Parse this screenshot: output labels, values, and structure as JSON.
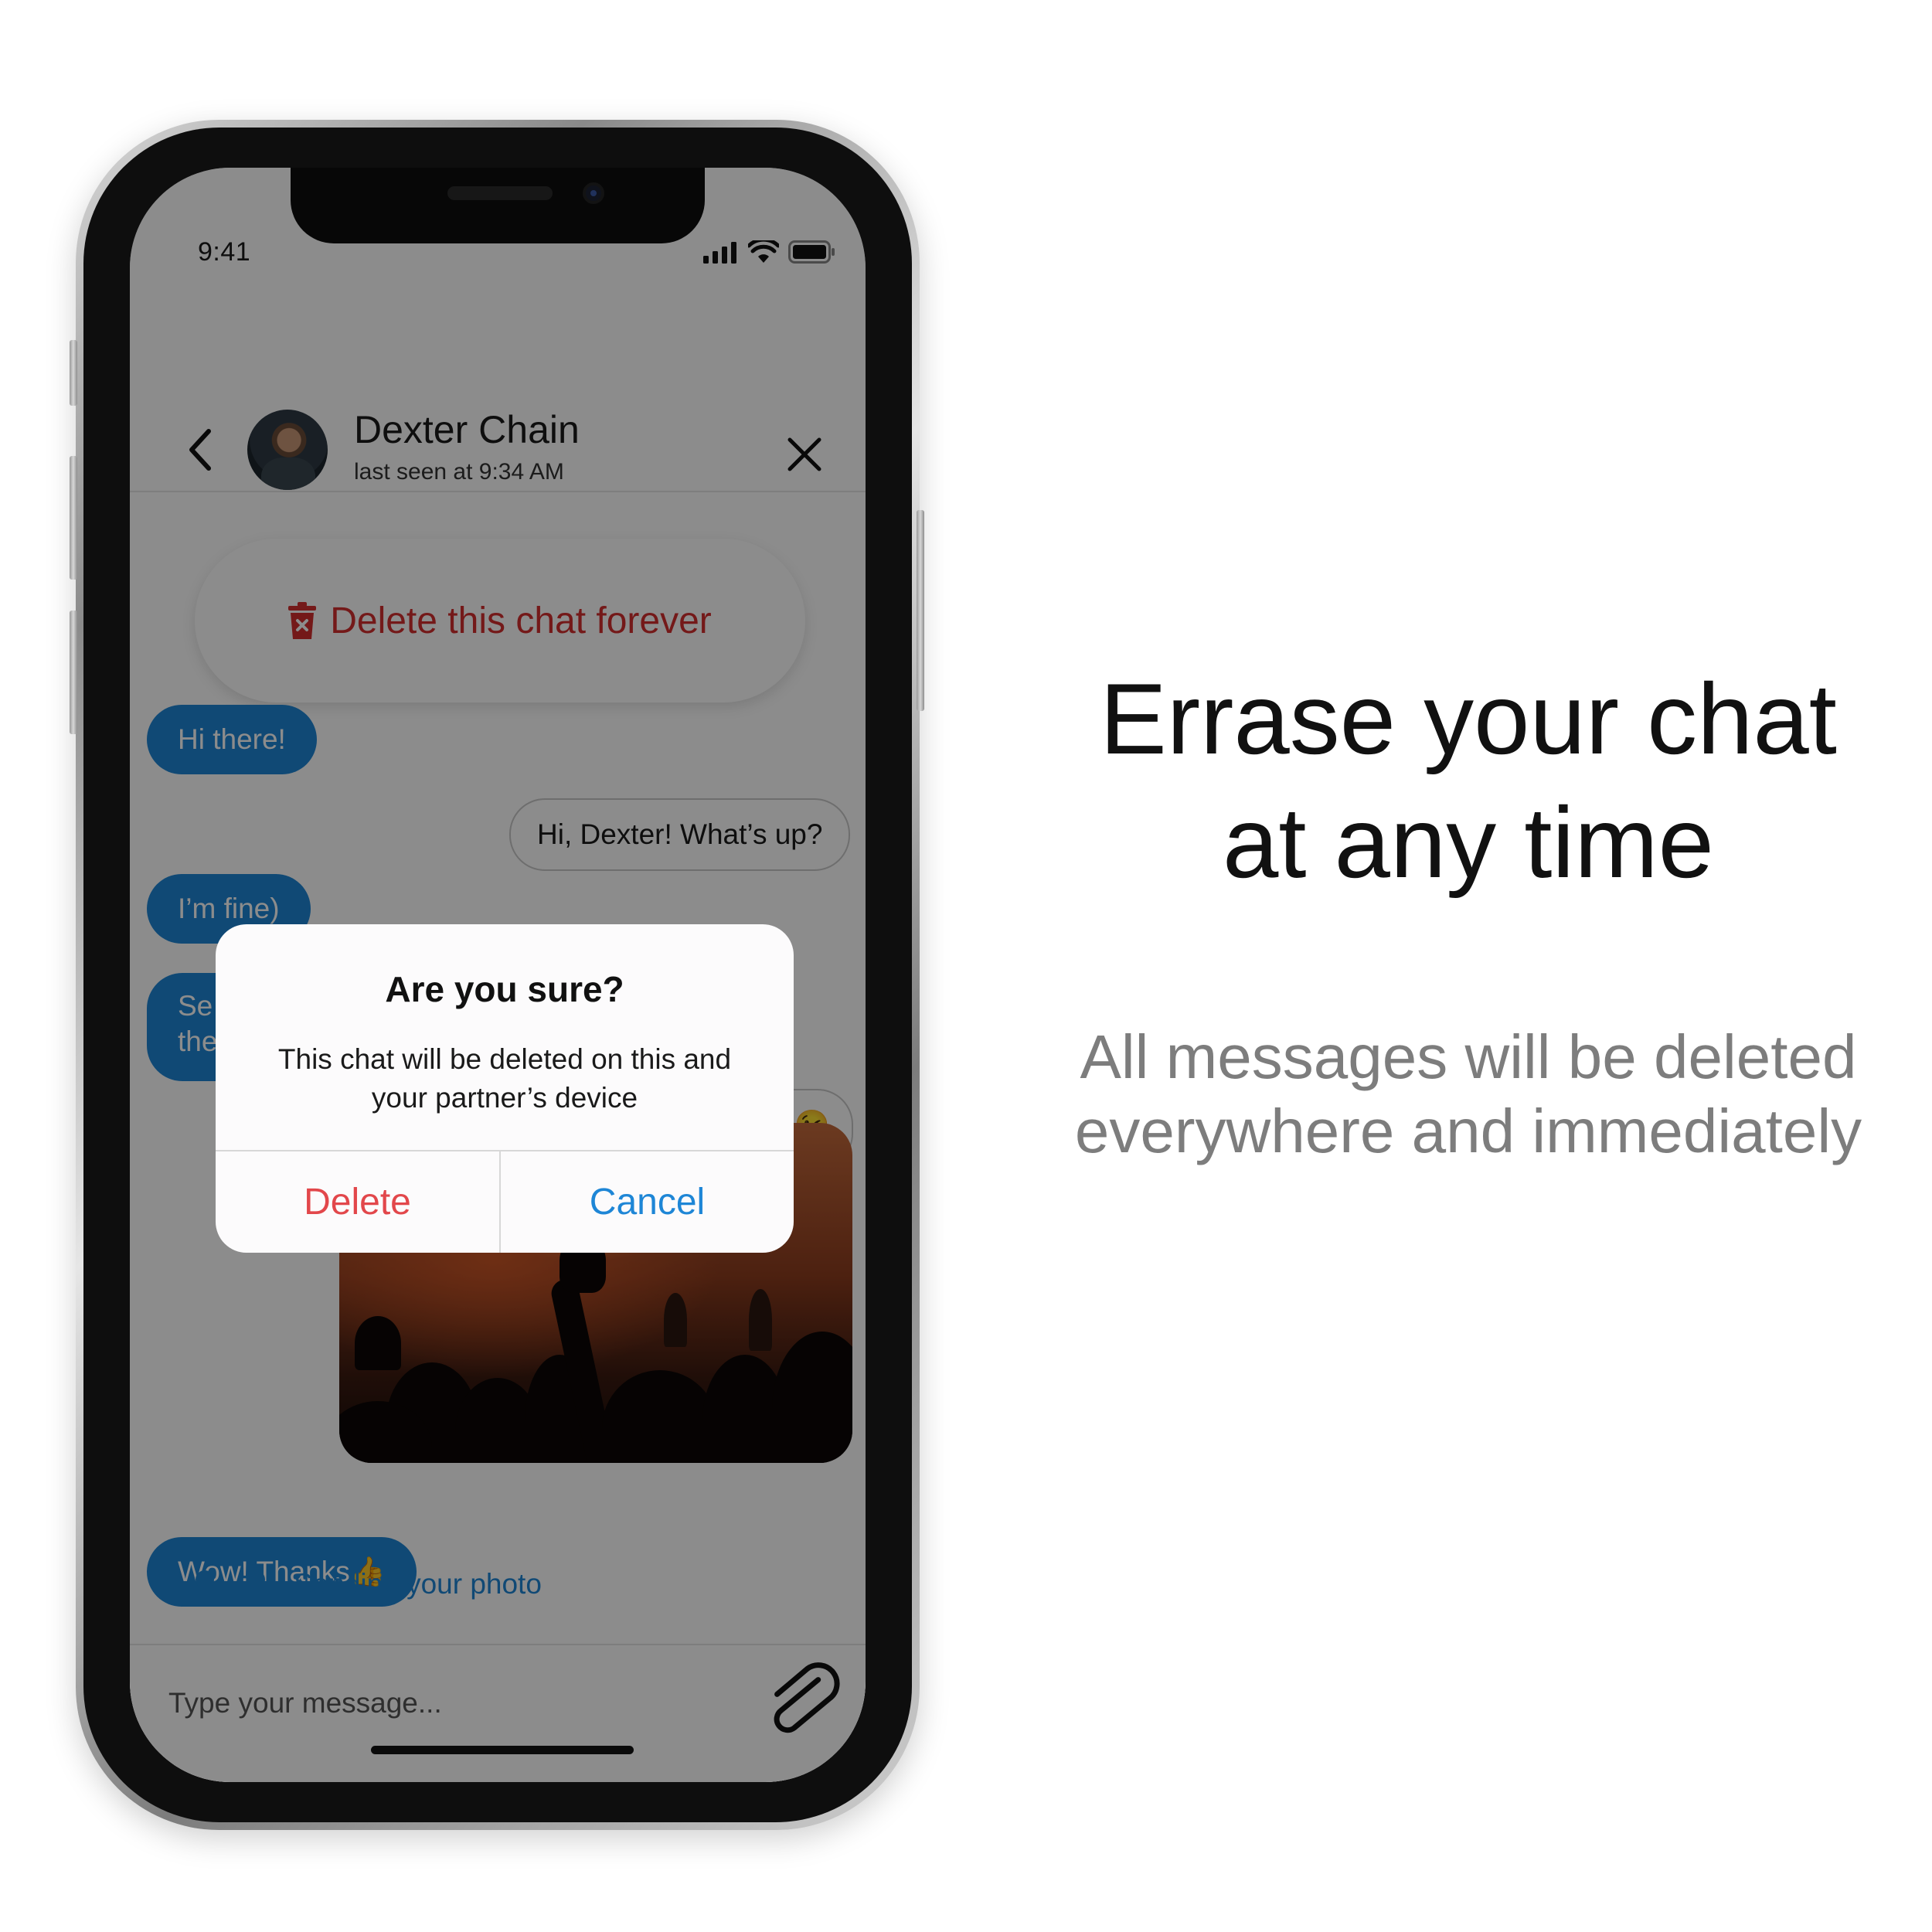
{
  "status_bar": {
    "time": "9:41"
  },
  "header": {
    "contact_name": "Dexter Chain",
    "contact_status": "last seen at 9:34 AM"
  },
  "actions": {
    "delete_chat_label": "Delete this chat forever"
  },
  "messages": [
    {
      "direction": "in",
      "text": "Hi there!"
    },
    {
      "direction": "out",
      "text": "Hi, Dexter! What’s up?"
    },
    {
      "direction": "in",
      "text": "I’m fine)"
    },
    {
      "direction": "in",
      "text": "Se… the…"
    },
    {
      "direction": "out",
      "text": "😉"
    },
    {
      "direction": "out",
      "type": "photo",
      "description": "concert"
    },
    {
      "direction": "in",
      "text": "Wow! Thanks👍"
    }
  ],
  "typing": {
    "label": "Sending your photo"
  },
  "composer": {
    "placeholder": "Type your message..."
  },
  "dialog": {
    "title": "Are you sure?",
    "message": "This chat will be deleted on this and your partner’s device",
    "delete_label": "Delete",
    "cancel_label": "Cancel"
  },
  "promo": {
    "headline_line1": "Errase your chat",
    "headline_line2": "at any time",
    "subline_line1": "All messages will be deleted",
    "subline_line2": "everywhere and immediately"
  },
  "colors": {
    "accent": "#1e86d6",
    "danger": "#d32f2f",
    "dialog_delete": "#e2474b",
    "overlay": "rgba(0,0,0,0.45)"
  }
}
